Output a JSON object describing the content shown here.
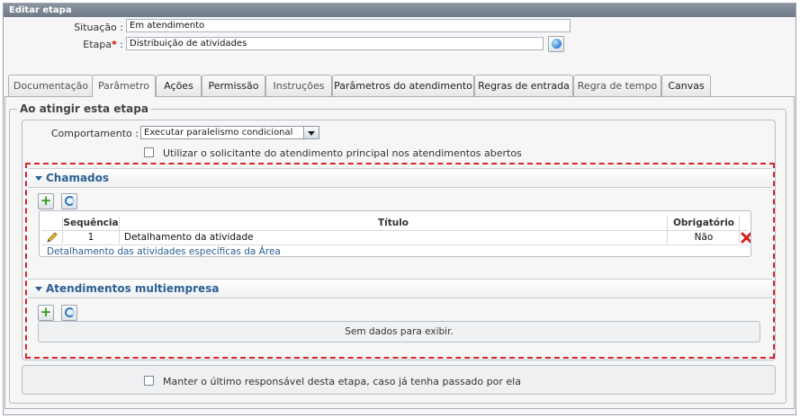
{
  "window": {
    "title": "Editar etapa"
  },
  "form": {
    "situacao_label": "Situação :",
    "situacao_value": "Em atendimento",
    "etapa_label": "Etapa",
    "etapa_req": "*",
    "etapa_sep": " :",
    "etapa_value": "Distribuição de atividades"
  },
  "tabs": [
    {
      "label": "Documentação"
    },
    {
      "label": "Parâmetro"
    },
    {
      "label": "Ações"
    },
    {
      "label": "Permissão"
    },
    {
      "label": "Instruções"
    },
    {
      "label": "Parâmetros do atendimento"
    },
    {
      "label": "Regras de entrada"
    },
    {
      "label": "Regra de tempo"
    },
    {
      "label": "Canvas"
    }
  ],
  "fieldset": {
    "legend": "Ao atingir esta etapa"
  },
  "behavior": {
    "label": "Comportamento :",
    "selected": "Executar paralelismo condicional",
    "checkbox_label": "Utilizar o solicitante do atendimento principal nos atendimentos abertos",
    "checkbox_checked": false
  },
  "chamados": {
    "title": "Chamados",
    "columns": [
      "Sequência",
      "Título",
      "Obrigatório"
    ],
    "rows": [
      {
        "seq": "1",
        "titulo": "Detalhamento da atividade",
        "obrigatorio": "Não",
        "descricao": "Detalhamento das atividades específicas da Área"
      }
    ]
  },
  "multiempresa": {
    "title": "Atendimentos multiempresa",
    "empty_text": "Sem dados para exibir."
  },
  "footer": {
    "checkbox_label": "Manter o último responsável desta etapa, caso já tenha passado por ela",
    "checkbox_checked": false
  },
  "colors": {
    "accent": "#2c5f93",
    "highlight_border": "#d6262b",
    "titlebar": "#7a8593"
  },
  "icons": [
    "globe-icon",
    "chevron-down-icon",
    "collapse-triangle-icon",
    "add-icon",
    "refresh-icon",
    "pencil-icon",
    "delete-icon"
  ]
}
